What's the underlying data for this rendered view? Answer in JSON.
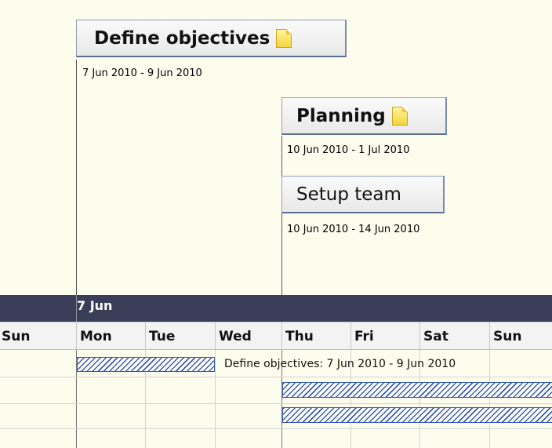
{
  "tasks": [
    {
      "name": "Define objectives",
      "dates": "7 Jun 2010 - 9 Jun 2010",
      "icon": "note-icon"
    },
    {
      "name": "Planning",
      "dates": "10 Jun 2010 - 1 Jul 2010",
      "icon": "note-icon"
    },
    {
      "name": "Setup team",
      "dates": "10 Jun 2010 - 14 Jun 2010"
    }
  ],
  "timeline": {
    "month_label": "7 Jun",
    "days": [
      "Sun",
      "Mon",
      "Tue",
      "Wed",
      "Thu",
      "Fri",
      "Sat",
      "Sun"
    ]
  },
  "bars": {
    "define_label": "Define objectives: 7 Jun 2010 - 9 Jun 2010"
  },
  "colors": {
    "background": "#fdfdee",
    "month_band": "#3a3d57",
    "bar_hatch": "#3a5bb5"
  }
}
